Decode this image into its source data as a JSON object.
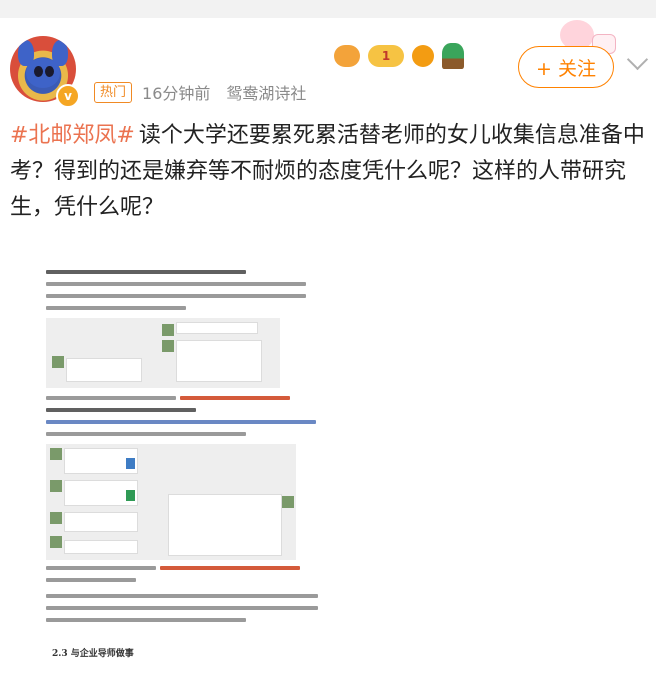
{
  "header": {
    "hot_label": "热门",
    "time": "16分钟前",
    "source": "鸳鸯湖诗社",
    "follow_label": "+ 关注",
    "badge_number": "1"
  },
  "post": {
    "hashtag": "#北邮郑凤#",
    "text": "读个大学还要累死累活替老师的女儿收集信息准备中考？得到的还是嫌弃等不耐烦的态度凭什么呢？这样的人带研究生，凭什么呢？"
  },
  "document": {
    "heading": "2.3 与企业导师做事"
  },
  "colors": {
    "accent": "#ff8200",
    "hashtag": "#eb7350",
    "hot": "#f08a24"
  }
}
